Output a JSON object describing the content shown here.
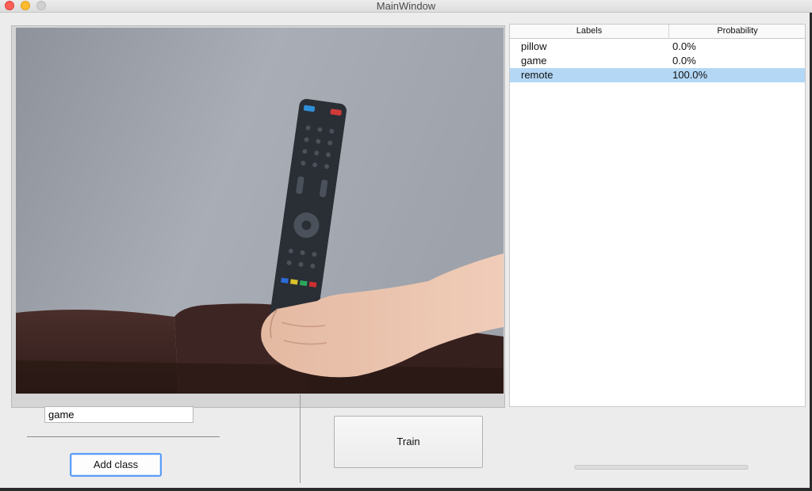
{
  "window": {
    "title": "MainWindow"
  },
  "table": {
    "headers": {
      "labels": "Labels",
      "probability": "Probability"
    },
    "rows": [
      {
        "label": "pillow",
        "probability": "0.0%",
        "selected": false
      },
      {
        "label": "game",
        "probability": "0.0%",
        "selected": false
      },
      {
        "label": "remote",
        "probability": "100.0%",
        "selected": true
      }
    ]
  },
  "controls": {
    "class_input_value": "game",
    "add_class_label": "Add class",
    "train_label": "Train",
    "progress": 0
  },
  "colors": {
    "selection": "#b3d7f5",
    "focus_ring": "#5b9df7"
  }
}
